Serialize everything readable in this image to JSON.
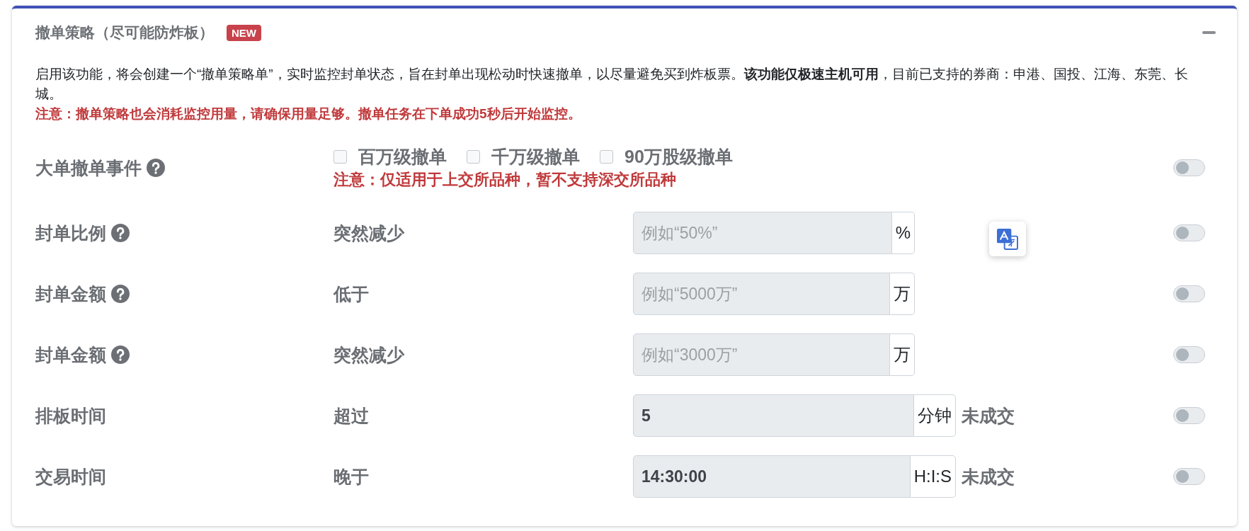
{
  "panel": {
    "title": "撤单策略（尽可能防炸板）",
    "badge": "NEW"
  },
  "description": "启用该功能，将会创建一个“撤单策略单”，实时监控封单状态，旨在封单出现松动时快速撤单，以尽量避免买到炸板票。**该功能仅极速主机可用**，目前已支持的券商：申港、国投、江海、东莞、长城。",
  "notice": "注意：撤单策略也会消耗监控用量，请确保用量足够。撤单任务在下单成功5秒后开始监控。",
  "rules": [
    {
      "kind": "checkboxes",
      "label": "大单撤单事件",
      "help": true,
      "options": [
        {
          "label": "百万级撤单",
          "checked": false
        },
        {
          "label": "千万级撤单",
          "checked": false
        },
        {
          "label": "90万股级撤单",
          "checked": false
        }
      ],
      "note": "注意：仅适用于上交所品种，暂不支持深交所品种",
      "on": false
    },
    {
      "kind": "input",
      "label": "封单比例",
      "help": true,
      "condition": "突然减少",
      "placeholder": "例如“50%”",
      "unit": "%",
      "on": false
    },
    {
      "kind": "input",
      "label": "封单金额",
      "help": true,
      "condition": "低于",
      "placeholder": "例如“5000万”",
      "unit": "万",
      "on": false
    },
    {
      "kind": "input",
      "label": "封单金额",
      "help": true,
      "condition": "突然减少",
      "placeholder": "例如“3000万”",
      "unit": "万",
      "on": false
    },
    {
      "kind": "input",
      "label": "排板时间",
      "help": false,
      "condition": "超过",
      "value": "5",
      "unit": "分钟",
      "suffix": "未成交",
      "on": false
    },
    {
      "kind": "input",
      "label": "交易时间",
      "help": false,
      "condition": "晚于",
      "value": "14:30:00",
      "unit": "H:I:S",
      "suffix": "未成交",
      "on": false
    }
  ]
}
